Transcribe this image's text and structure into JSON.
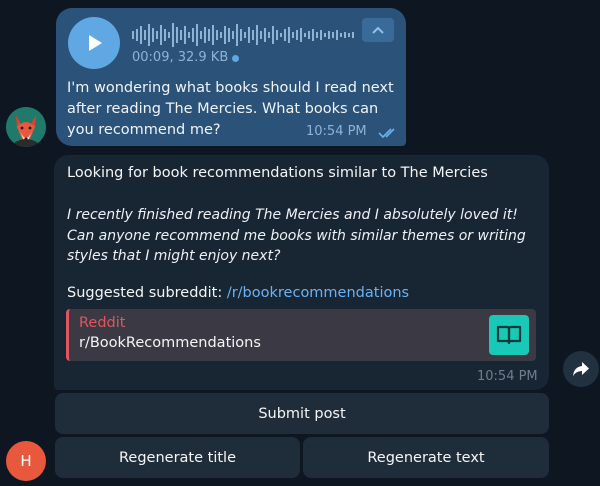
{
  "voice_message": {
    "duration": "00:09",
    "size": "32.9 KB",
    "meta_text": "00:09, 32.9 KB",
    "text": "I'm wondering what books should I read next after reading The Mercies. What books can you recommend me?",
    "time": "10:54 PM",
    "icons": {
      "play": "play-icon",
      "collapse": "chevron-up-icon",
      "read_status": "double-check-icon"
    }
  },
  "bot_message": {
    "title": "Looking for book recommendations similar to The Mercies",
    "body": "I recently finished reading The Mercies and I absolutely loved it! Can anyone recommend me books with similar themes or writing styles that I might enjoy next?",
    "subreddit_label": "Suggested subreddit: ",
    "subreddit_link": "/r/bookrecommendations",
    "link_preview": {
      "site": "Reddit",
      "title": "r/BookRecommendations",
      "thumb_icon": "book-icon"
    },
    "time": "10:54 PM"
  },
  "keyboard": {
    "submit": "Submit post",
    "regenerate_title": "Regenerate title",
    "regenerate_text": "Regenerate text"
  },
  "user_avatar": {
    "initial": "H"
  },
  "colors": {
    "background": "#0e1621",
    "outgoing_bubble": "#2b5278",
    "incoming_bubble": "#182533",
    "link": "#6ab3f3",
    "preview_accent": "#e0565e",
    "preview_thumb": "#1ac8b8",
    "user_avatar": "#e8583d"
  }
}
